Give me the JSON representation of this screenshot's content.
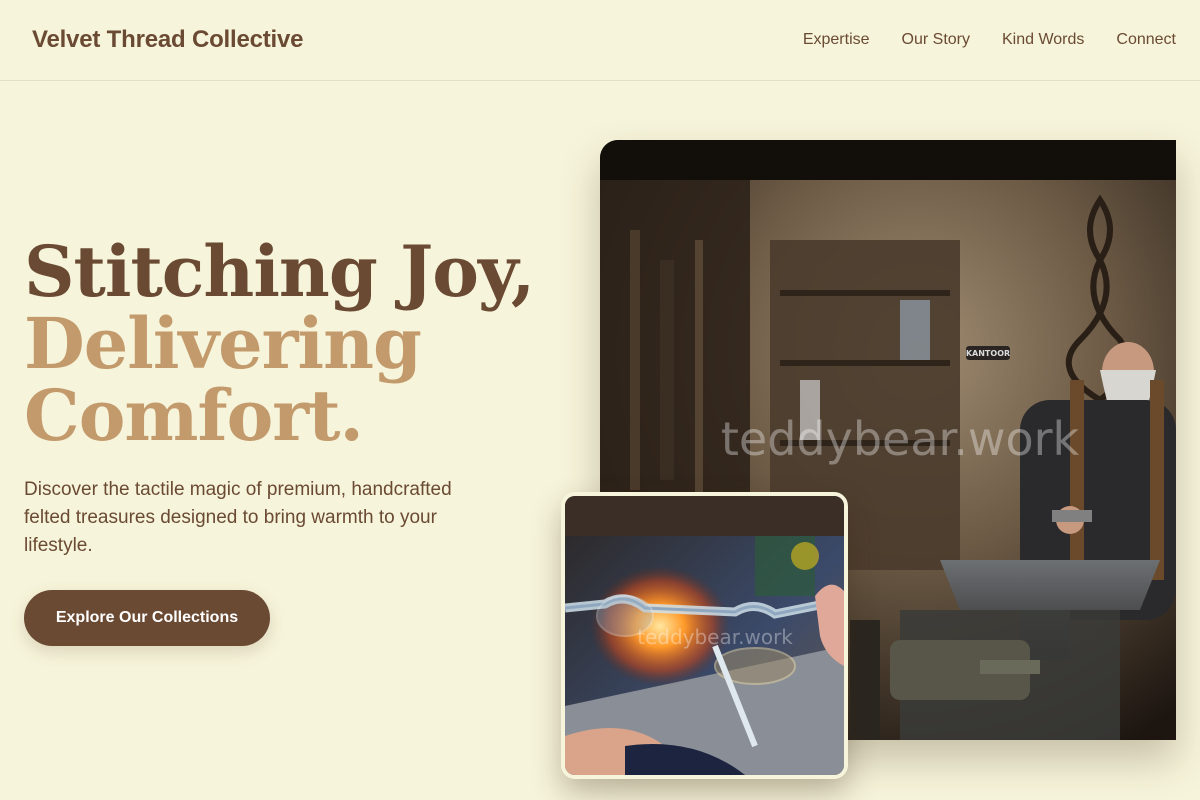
{
  "header": {
    "brand": "Velvet Thread Collective",
    "nav": [
      "Expertise",
      "Our Story",
      "Kind Words",
      "Connect"
    ]
  },
  "hero": {
    "title_line1": "Stitching Joy,",
    "title_line2": "Delivering",
    "title_line3": "Comfort.",
    "description": "Discover the tactile magic of premium, handcrafted felted treasures designed to bring warmth to your lifestyle.",
    "cta_label": "Explore Our Collections"
  },
  "images": {
    "main_watermark": "teddybear.work",
    "main_sign": "KANTOOR",
    "small_watermark": "teddybear.work"
  },
  "colors": {
    "background": "#f6f4da",
    "primary_brown": "#6b4a34",
    "accent_tan": "#c39a6b"
  }
}
